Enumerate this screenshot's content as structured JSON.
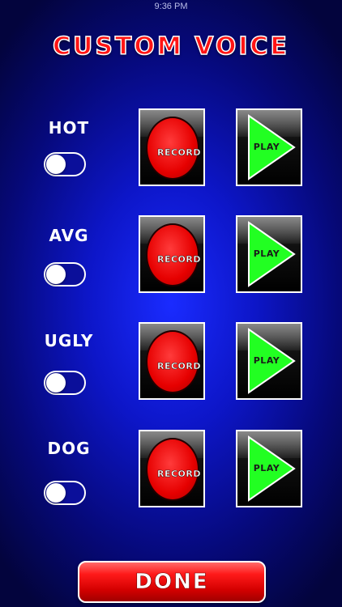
{
  "status_bar": {
    "time": "9:36 PM"
  },
  "title": "CUSTOM VOICE",
  "rows": [
    {
      "label": "HOT",
      "record_label": "RECORD",
      "play_label": "PLAY"
    },
    {
      "label": "AVG",
      "record_label": "RECORD",
      "play_label": "PLAY"
    },
    {
      "label": "UGLY",
      "record_label": "RECORD",
      "play_label": "PLAY"
    },
    {
      "label": "DOG",
      "record_label": "RECORD",
      "play_label": "PLAY"
    }
  ],
  "done_label": "DONE",
  "colors": {
    "background": "#0d16c8",
    "title_red": "#ff1414",
    "record_red": "#e60000",
    "play_green": "#22ff22"
  }
}
